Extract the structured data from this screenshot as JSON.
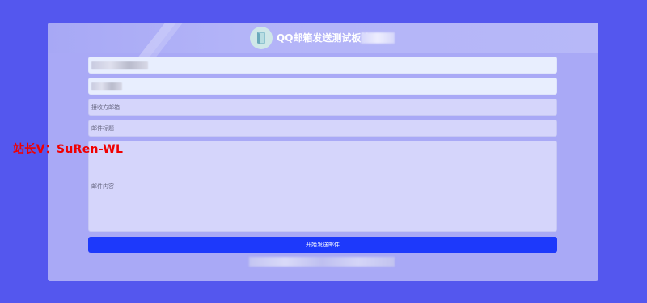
{
  "header": {
    "title": "QQ邮箱发送测试板块",
    "logo_icon": "book-logo-icon"
  },
  "form": {
    "sender_email_placeholder": "",
    "sender_auth_placeholder": "",
    "receiver_label": "接收方邮箱",
    "subject_label": "邮件标题",
    "content_label": "邮件内容"
  },
  "button": {
    "send_label": "开始发送邮件"
  },
  "watermark": {
    "text": "站长V：SuRen-WL"
  },
  "colors": {
    "background": "#5457ee",
    "card": "#a9a9f6",
    "button": "#1d39fb",
    "watermark": "#f00000"
  }
}
